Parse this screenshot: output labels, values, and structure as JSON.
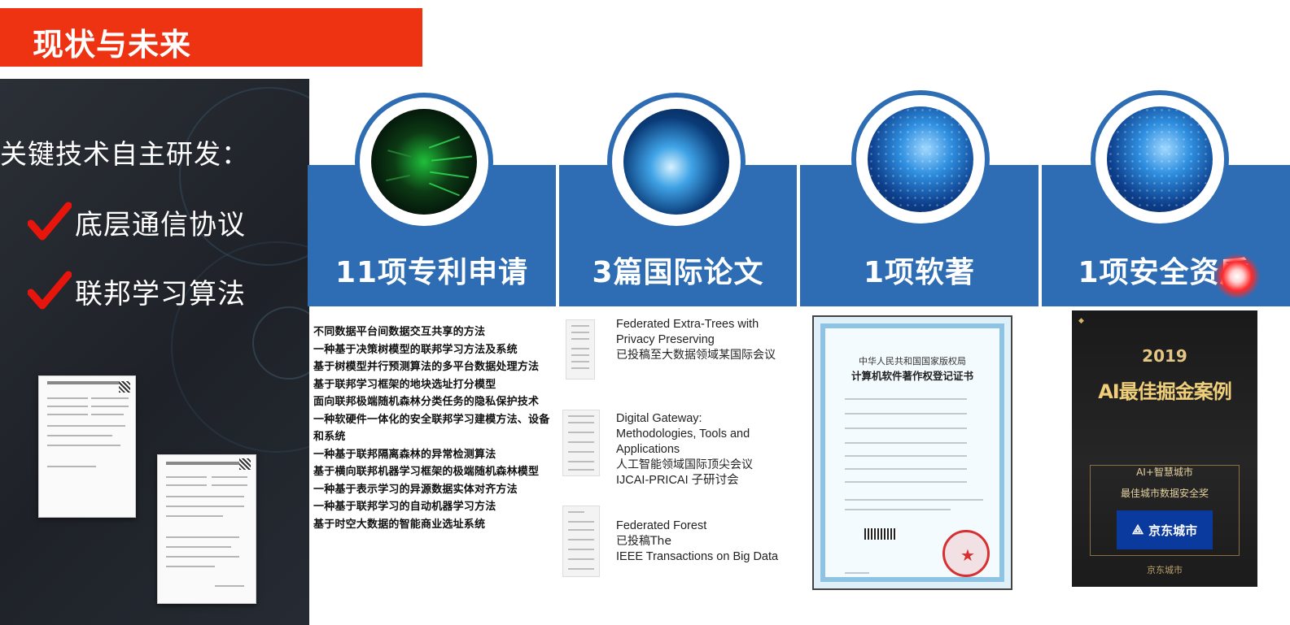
{
  "slide": {
    "title": "现状与未来",
    "colors": {
      "accent_red": "#ee3312",
      "band_blue": "#2e6db4",
      "left_panel": "#23272e"
    }
  },
  "left_panel": {
    "heading": "关键技术自主研发：",
    "items": [
      {
        "label": "底层通信协议",
        "icon": "red-check-icon"
      },
      {
        "label": "联邦学习算法",
        "icon": "red-check-icon"
      }
    ]
  },
  "band": {
    "columns": [
      {
        "label": "11项专利申请",
        "icon": "digital-tunnel-image"
      },
      {
        "label": "3篇国际论文",
        "icon": "network-globe-image"
      },
      {
        "label": "1项软著",
        "icon": "data-globe-image"
      },
      {
        "label": "1项安全资质",
        "icon": "data-globe-image"
      }
    ]
  },
  "patents": [
    "不同数据平台间数据交互共享的方法",
    "一种基于决策树模型的联邦学习方法及系统",
    "基于树模型并行预测算法的多平台数据处理方法",
    "基于联邦学习框架的地块选址打分模型",
    "面向联邦极端随机森林分类任务的隐私保护技术",
    "一种软硬件一体化的安全联邦学习建模方法、设备和系统",
    "一种基于联邦隔离森林的异常检测算法",
    "基于横向联邦机器学习框架的极端随机森林模型",
    "一种基于表示学习的异源数据实体对齐方法",
    "一种基于联邦学习的自动机器学习方法",
    "基于时空大数据的智能商业选址系统"
  ],
  "papers": [
    {
      "line1": "Federated Extra-Trees with",
      "line2": "Privacy Preserving",
      "line3": "已投稿至大数据领域某国际会议",
      "line4": ""
    },
    {
      "line1": "Digital Gateway:",
      "line2": "Methodologies, Tools and",
      "line3": "Applications",
      "line4": "人工智能领域国际顶尖会议",
      "line5": "IJCAI-PRICAI 子研讨会"
    },
    {
      "line1": "Federated Forest",
      "line2": "已投稿The",
      "line3": "IEEE Transactions on Big Data"
    }
  ],
  "certificate": {
    "issuer": "中华人民共和国国家版权局",
    "title": "计算机软件著作权登记证书"
  },
  "award": {
    "year": "2019",
    "headline": "AI最佳掘金案例",
    "tag": "AI+智慧城市",
    "prize": "最佳城市数据安全奖",
    "logo_text": "京东城市",
    "footer": "京东城市"
  }
}
